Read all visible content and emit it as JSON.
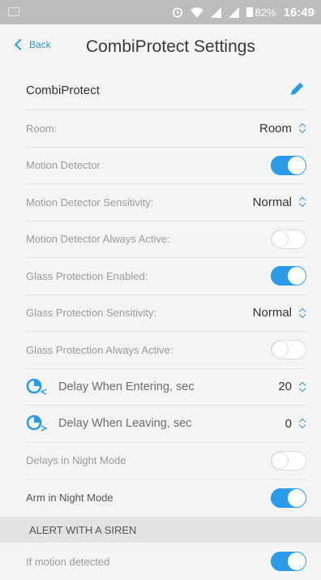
{
  "statusbar": {
    "battery": "82%",
    "time": "16:49"
  },
  "nav": {
    "back_label": "Back",
    "title": "CombiProtect Settings"
  },
  "device": {
    "name": "CombiProtect"
  },
  "rows": {
    "room": {
      "label": "Room:",
      "value": "Room"
    },
    "motion_detector": {
      "label": "Motion Detector",
      "on": true
    },
    "motion_sensitivity": {
      "label": "Motion Detector Sensitivity:",
      "value": "Normal"
    },
    "motion_always_active": {
      "label": "Motion Detector Always Active:",
      "on": false
    },
    "glass_enabled": {
      "label": "Glass Protection Enabled:",
      "on": true
    },
    "glass_sensitivity": {
      "label": "Glass Protection Sensitivity:",
      "value": "Normal"
    },
    "glass_always_active": {
      "label": "Glass Protection Always Active:",
      "on": false
    },
    "delay_entering": {
      "label": "Delay When Entering, sec",
      "value": "20"
    },
    "delay_leaving": {
      "label": "Delay When Leaving, sec",
      "value": "0"
    },
    "night_delays": {
      "label": "Delays in Night Mode",
      "on": false
    },
    "arm_night": {
      "label": "Arm in Night Mode",
      "on": true
    }
  },
  "siren_section": {
    "title": "ALERT WITH A SIREN",
    "if_motion": {
      "label": "If motion detected",
      "on": true
    }
  },
  "colors": {
    "accent": "#2a9be8",
    "statusbar": "#bdbdbd",
    "background": "#f4f4f4"
  }
}
